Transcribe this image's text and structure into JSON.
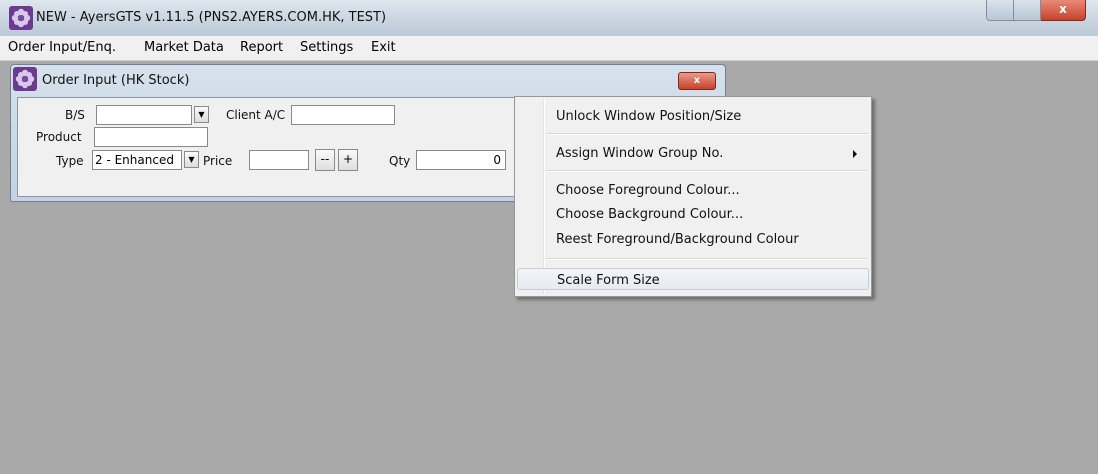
{
  "window": {
    "title": "NEW - AyersGTS v1.11.5 (PNS2.AYERS.COM.HK, TEST)",
    "close_glyph": "x"
  },
  "menubar": {
    "items": [
      "Order Input/Enq.",
      "Market Data",
      "Report",
      "Settings",
      "Exit"
    ]
  },
  "order_window": {
    "title": "Order Input (HK Stock)",
    "close_glyph": "x",
    "labels": {
      "bs": "B/S",
      "client": "Client A/C",
      "product": "Product",
      "type": "Type",
      "price": "Price",
      "qty": "Qty"
    },
    "values": {
      "bs": "",
      "client": "",
      "product": "",
      "type": "2 - Enhanced",
      "price": "",
      "qty": "0"
    },
    "buttons": {
      "minus": "--",
      "plus": "+"
    }
  },
  "context_menu": {
    "items": [
      "Unlock Window Position/Size",
      "Assign Window Group No.",
      "Choose Foreground Colour...",
      "Choose Background Colour...",
      "Reest Foreground/Background Colour",
      "Scale Form Size"
    ]
  },
  "colors": {
    "desktop": "#a9a9a9",
    "titlebar": "#c9d4e0",
    "close_red": "#c8412b",
    "menu_bg": "#f0f0f0"
  },
  "icons": {
    "app": "ayers-flower-icon",
    "dropdown": "chevron-down-icon",
    "submenu": "chevron-right-icon"
  }
}
